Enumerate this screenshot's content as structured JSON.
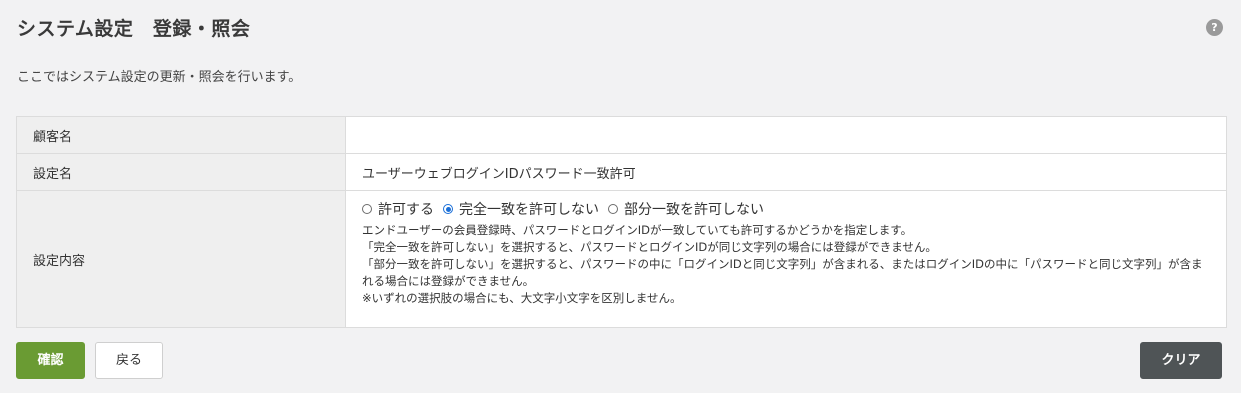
{
  "header": {
    "title": "システム設定　登録・照会",
    "help_icon": "?"
  },
  "description": "ここではシステム設定の更新・照会を行います。",
  "form": {
    "customer_label": "顧客名",
    "customer_value": "",
    "setting_name_label": "設定名",
    "setting_name_value": "ユーザーウェブログインIDパスワード一致許可",
    "content_label": "設定内容",
    "options": [
      {
        "label": "許可する",
        "checked": false
      },
      {
        "label": "完全一致を許可しない",
        "checked": true
      },
      {
        "label": "部分一致を許可しない",
        "checked": false
      }
    ],
    "help_lines": [
      "エンドユーザーの会員登録時、パスワードとログインIDが一致していても許可するかどうかを指定します。",
      "「完全一致を許可しない」を選択すると、パスワードとログインIDが同じ文字列の場合には登録ができません。",
      "「部分一致を許可しない」を選択すると、パスワードの中に「ログインIDと同じ文字列」が含まれる、またはログインIDの中に「パスワードと同じ文字列」が含まれる場合には登録ができません。",
      "※いずれの選択肢の場合にも、大文字小文字を区別しません。"
    ]
  },
  "buttons": {
    "confirm": "確認",
    "back": "戻る",
    "clear": "クリア"
  },
  "colors": {
    "confirm": "#6a9b33",
    "clear": "#4f5456",
    "radio_selected": "#1a6fd8"
  }
}
